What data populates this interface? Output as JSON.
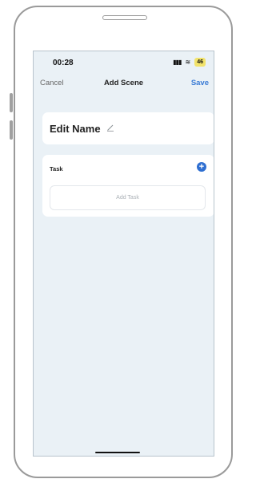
{
  "status_bar": {
    "time": "00:28",
    "battery": "46"
  },
  "nav": {
    "cancel_label": "Cancel",
    "title": "Add Scene",
    "save_label": "Save"
  },
  "scene": {
    "name_label": "Edit Name"
  },
  "task_section": {
    "label": "Task",
    "add_task_label": "Add Task"
  },
  "colors": {
    "accent": "#3a7bd5",
    "background": "#eaf1f6",
    "battery": "#f2e36b"
  }
}
